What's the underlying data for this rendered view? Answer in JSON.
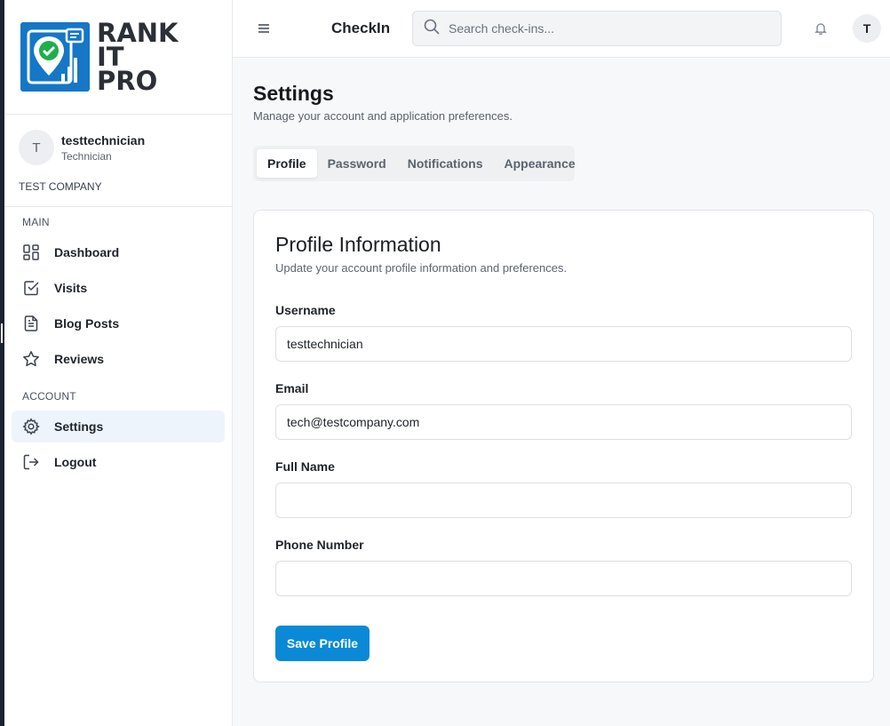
{
  "brand": {
    "logo_lines": [
      "RANK",
      "IT",
      "PRO"
    ],
    "logo_color": "#1577c6",
    "check_color": "#1fae4b"
  },
  "user": {
    "initial": "T",
    "name": "testtechnician",
    "role": "Technician",
    "company": "TEST COMPANY"
  },
  "sidebar": {
    "sections": [
      {
        "label": "MAIN",
        "items": [
          {
            "label": "Dashboard",
            "icon": "dashboard-icon"
          },
          {
            "label": "Visits",
            "icon": "checkbox-icon"
          },
          {
            "label": "Blog Posts",
            "icon": "document-icon"
          },
          {
            "label": "Reviews",
            "icon": "star-icon"
          }
        ]
      },
      {
        "label": "ACCOUNT",
        "items": [
          {
            "label": "Settings",
            "icon": "gear-icon",
            "active": true
          },
          {
            "label": "Logout",
            "icon": "logout-icon"
          }
        ]
      }
    ]
  },
  "header": {
    "menu_icon": "hamburger-icon",
    "app_title": "CheckIn",
    "search_placeholder": "Search check-ins...",
    "search_icon": "search-icon",
    "bell_icon": "bell-icon",
    "avatar_initial": "T"
  },
  "page": {
    "title": "Settings",
    "subtitle": "Manage your account and application preferences."
  },
  "tabs": [
    {
      "label": "Profile",
      "active": true
    },
    {
      "label": "Password"
    },
    {
      "label": "Notifications"
    },
    {
      "label": "Appearance"
    }
  ],
  "profile_card": {
    "title": "Profile Information",
    "subtitle": "Update your account profile information and preferences.",
    "fields": [
      {
        "label": "Username",
        "value": "testtechnician"
      },
      {
        "label": "Email",
        "value": "tech@testcompany.com"
      },
      {
        "label": "Full Name",
        "value": ""
      },
      {
        "label": "Phone Number",
        "value": ""
      }
    ],
    "save_label": "Save Profile"
  },
  "colors": {
    "accent": "#0a8ad6",
    "active_nav_bg": "#eef4fb"
  }
}
